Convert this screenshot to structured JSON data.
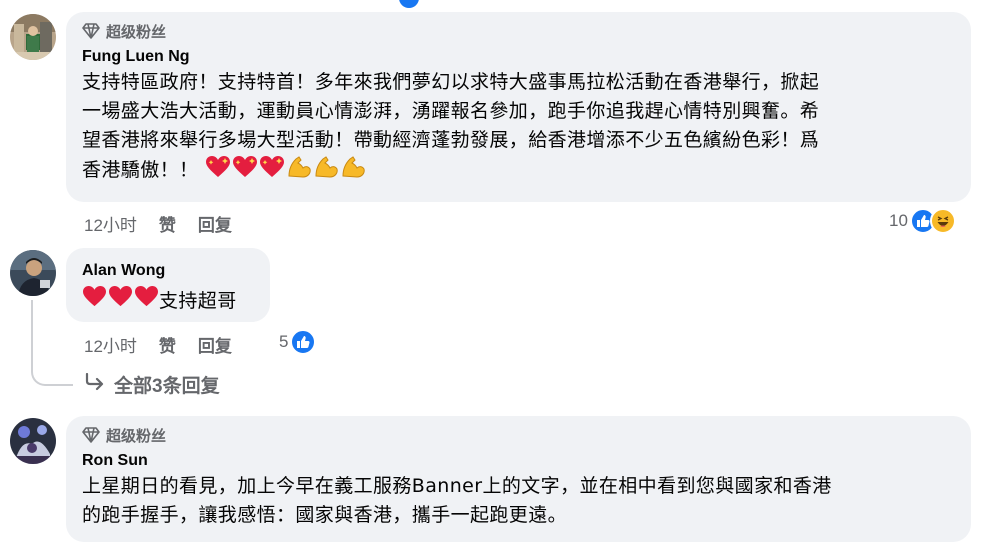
{
  "comments": [
    {
      "badge": "超级粉丝",
      "author": "Fung Luen Ng",
      "text_lines": [
        "支持特區政府！支持特首！多年來我們夢幻以求特大盛事馬拉松活動在香港舉行，掀起",
        "一場盛大浩大活動，運動員心情澎湃，湧躍報名參加，跑手你追我趕心情特別興奮。希",
        "望香港將來舉行多場大型活動！帶動經濟蓬勃發展，給香港增添不少五色繽紛色彩！爲",
        "香港驕傲！！"
      ],
      "emojis": [
        "sparkling-heart",
        "sparkling-heart",
        "sparkling-heart",
        "flexed-biceps",
        "flexed-biceps",
        "flexed-biceps"
      ],
      "time": "12小时",
      "like_label": "赞",
      "reply_label": "回复",
      "reaction_count": "10",
      "reactions": [
        "like",
        "haha"
      ]
    },
    {
      "author": "Alan Wong",
      "emojis": [
        "red-heart",
        "red-heart",
        "red-heart"
      ],
      "text": "支持超哥",
      "time": "12小时",
      "like_label": "赞",
      "reply_label": "回复",
      "reaction_count": "5",
      "reactions": [
        "like"
      ]
    },
    {
      "badge": "超级粉丝",
      "author": "Ron Sun",
      "text_lines": [
        "上星期日的看見，加上今早在義工服務Banner上的文字，並在相中看到您與國家和香港",
        "的跑手握手，讓我感悟：國家與香港，攜手一起跑更遠。"
      ]
    }
  ],
  "view_replies": "全部3条回复",
  "colors": {
    "bubble": "#f0f2f5",
    "secondary_text": "#65676b",
    "like_blue": "#1877f2",
    "haha_yellow": "#f7b928",
    "heart_red": "#e41e3f",
    "biceps_yellow": "#f7b928"
  }
}
